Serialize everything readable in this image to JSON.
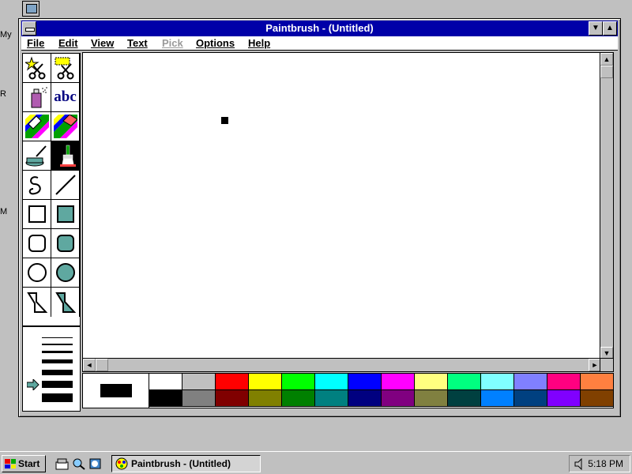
{
  "desktop": {
    "icon_fragments": [
      "My",
      "R",
      "M"
    ]
  },
  "window": {
    "title": "Paintbrush - (Untitled)",
    "minimize_symbol": "▼",
    "maximize_symbol": "▲"
  },
  "menu": [
    {
      "label": "File",
      "enabled": true
    },
    {
      "label": "Edit",
      "enabled": true
    },
    {
      "label": "View",
      "enabled": true
    },
    {
      "label": "Text",
      "enabled": true
    },
    {
      "label": "Pick",
      "enabled": false
    },
    {
      "label": "Options",
      "enabled": true
    },
    {
      "label": "Help",
      "enabled": true
    }
  ],
  "tools": [
    {
      "name": "scissors-tool-icon"
    },
    {
      "name": "pick-tool-icon"
    },
    {
      "name": "airbrush-tool-icon"
    },
    {
      "name": "text-tool-icon",
      "label": "abc"
    },
    {
      "name": "color-eraser-tool-icon"
    },
    {
      "name": "eraser-tool-icon"
    },
    {
      "name": "paint-roller-tool-icon"
    },
    {
      "name": "brush-tool-icon",
      "selected": true
    },
    {
      "name": "curve-tool-icon"
    },
    {
      "name": "line-tool-icon"
    },
    {
      "name": "box-tool-icon"
    },
    {
      "name": "filled-box-tool-icon"
    },
    {
      "name": "rounded-box-tool-icon"
    },
    {
      "name": "filled-rounded-box-tool-icon"
    },
    {
      "name": "circle-tool-icon"
    },
    {
      "name": "filled-circle-tool-icon"
    },
    {
      "name": "polygon-tool-icon"
    },
    {
      "name": "filled-polygon-tool-icon"
    }
  ],
  "line_widths": {
    "count": 7,
    "selected_index": 4,
    "indicator_icon": "arrow-right-icon"
  },
  "palette": {
    "foreground": "#000000",
    "background": "#ffffff",
    "colors_top": [
      "#ffffff",
      "#c0c0c0",
      "#ff0000",
      "#ffff00",
      "#00ff00",
      "#00ffff",
      "#0000ff",
      "#ff00ff",
      "#ffff80",
      "#00ff80",
      "#80ffff",
      "#8080ff",
      "#ff0080",
      "#ff8040"
    ],
    "colors_bottom": [
      "#000000",
      "#808080",
      "#800000",
      "#808000",
      "#008000",
      "#008080",
      "#000080",
      "#800080",
      "#808040",
      "#004040",
      "#0080ff",
      "#004080",
      "#8000ff",
      "#804000"
    ]
  },
  "taskbar": {
    "start_label": "Start",
    "task_label": "Paintbrush - (Untitled)",
    "clock": "5:18 PM"
  }
}
